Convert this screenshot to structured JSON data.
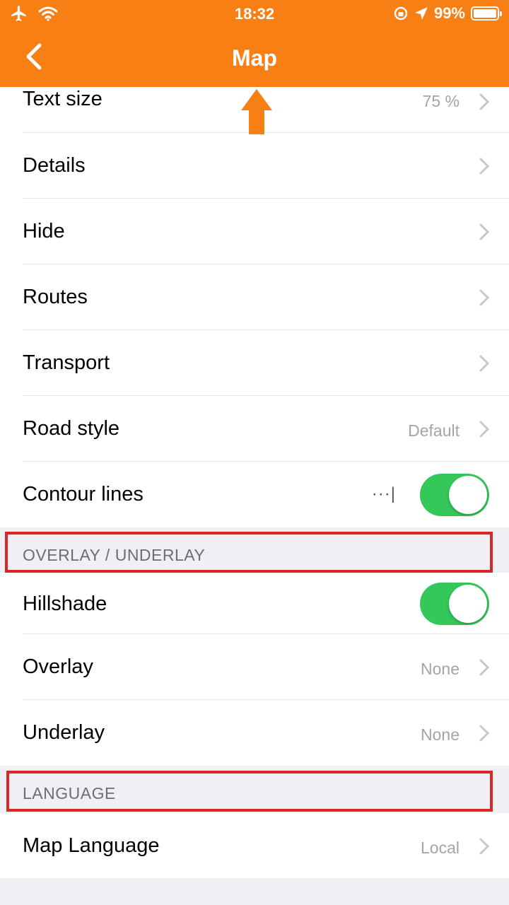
{
  "status_bar": {
    "time": "18:32",
    "battery": "99%",
    "icons": [
      "airplane-mode-icon",
      "wifi-icon",
      "orientation-lock-icon",
      "location-icon",
      "battery-icon"
    ]
  },
  "nav": {
    "title": "Map",
    "back_icon": "chevron-left-icon",
    "bg_color": "#f77f14"
  },
  "rows": {
    "text_size": {
      "label": "Text size",
      "value": "75 %"
    },
    "details": {
      "label": "Details"
    },
    "hide": {
      "label": "Hide"
    },
    "routes": {
      "label": "Routes"
    },
    "transport": {
      "label": "Transport"
    },
    "road_style": {
      "label": "Road style",
      "value": "Default"
    },
    "contour_lines": {
      "label": "Contour lines",
      "more": "···|",
      "toggle_on": true
    }
  },
  "sections": {
    "overlay": {
      "header": "OVERLAY / UNDERLAY",
      "hillshade": {
        "label": "Hillshade",
        "toggle_on": true
      },
      "overlay": {
        "label": "Overlay",
        "value": "None"
      },
      "underlay": {
        "label": "Underlay",
        "value": "None"
      }
    },
    "language": {
      "header": "LANGUAGE",
      "map_language": {
        "label": "Map Language",
        "value": "Local"
      }
    }
  },
  "colors": {
    "toggle_on": "#34c759",
    "annotation_red": "#d8262a",
    "annotation_arrow": "#f77f14"
  }
}
